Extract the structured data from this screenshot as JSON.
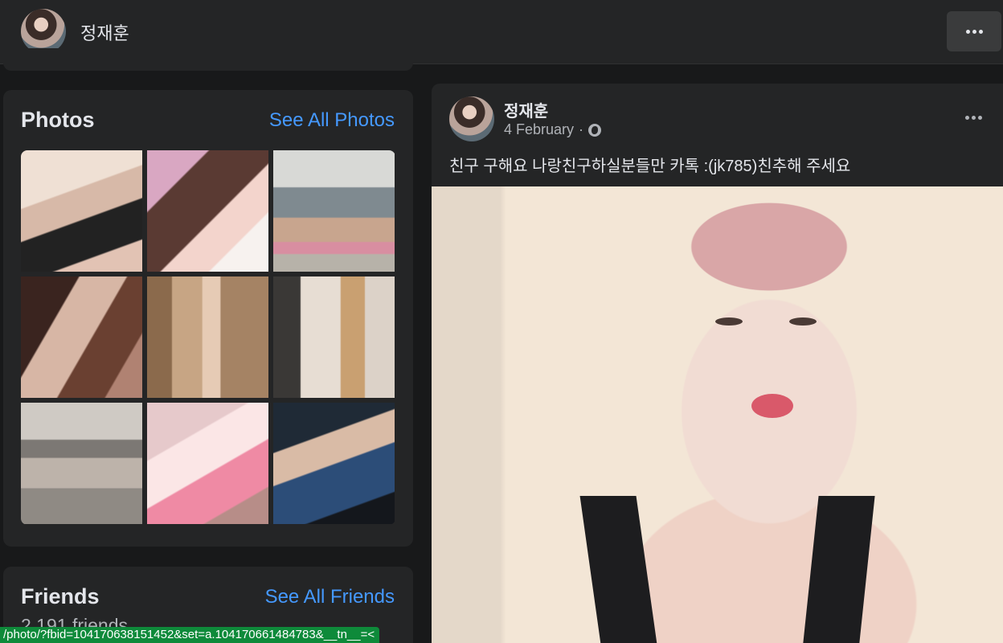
{
  "topbar": {
    "name": "정재훈",
    "more_icon": "more-horizontal-icon"
  },
  "photos": {
    "title": "Photos",
    "see_all": "See All Photos",
    "items": [
      "photo-1",
      "photo-2",
      "photo-3",
      "photo-4",
      "photo-5",
      "photo-6",
      "photo-7",
      "photo-8",
      "photo-9"
    ]
  },
  "friends": {
    "title": "Friends",
    "see_all": "See All Friends",
    "count": "2,191 friends"
  },
  "post": {
    "author": "정재훈",
    "date": "4 February",
    "separator": "·",
    "audience_icon": "globe-icon",
    "caption": "친구 구해요 나랑친구하실분들만 카톡 :(jk785)친추해 주세요"
  },
  "status_bar": {
    "url": "/photo/?fbid=104170638151452&set=a.104170661484783&__tn__=<"
  },
  "colors": {
    "background": "#18191a",
    "card": "#242526",
    "link": "#4599ff",
    "status": "#0e8a3a"
  }
}
